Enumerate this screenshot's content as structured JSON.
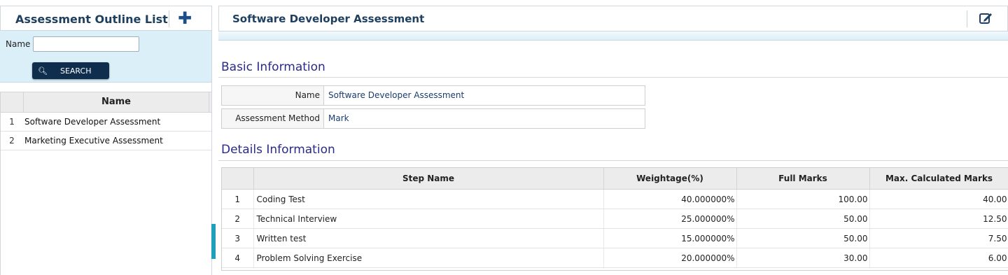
{
  "left_panel": {
    "title": "Assessment Outline List",
    "add_icon": "plus-icon",
    "search": {
      "name_label": "Name",
      "name_value": "",
      "button_label": "SEARCH",
      "button_icon": "search-icon"
    },
    "grid": {
      "header": "Name",
      "rows": [
        {
          "num": "1",
          "name": "Software Developer Assessment"
        },
        {
          "num": "2",
          "name": "Marketing Executive Assessment"
        }
      ]
    }
  },
  "right_panel": {
    "title": "Software Developer Assessment",
    "edit_icon": "edit-icon",
    "basic_info": {
      "title": "Basic Information",
      "fields": [
        {
          "label": "Name",
          "value": "Software Developer Assessment"
        },
        {
          "label": "Assessment Method",
          "value": "Mark"
        }
      ]
    },
    "details": {
      "title": "Details Information",
      "columns": [
        "Step Name",
        "Weightage(%)",
        "Full Marks",
        "Max. Calculated Marks"
      ],
      "rows": [
        {
          "num": "1",
          "step": "Coding Test",
          "weight": "40.000000%",
          "full": "100.00",
          "max": "40.00"
        },
        {
          "num": "2",
          "step": "Technical Interview",
          "weight": "25.000000%",
          "full": "50.00",
          "max": "12.50"
        },
        {
          "num": "3",
          "step": "Written test",
          "weight": "15.000000%",
          "full": "50.00",
          "max": "7.50"
        },
        {
          "num": "4",
          "step": "Problem Solving Exercise",
          "weight": "20.000000%",
          "full": "30.00",
          "max": "6.00"
        }
      ]
    }
  },
  "colors": {
    "header_text": "#1f3f5f",
    "section_title": "#2a2a8a",
    "search_button": "#0f2e4e",
    "accent": "#1fa0b8"
  }
}
